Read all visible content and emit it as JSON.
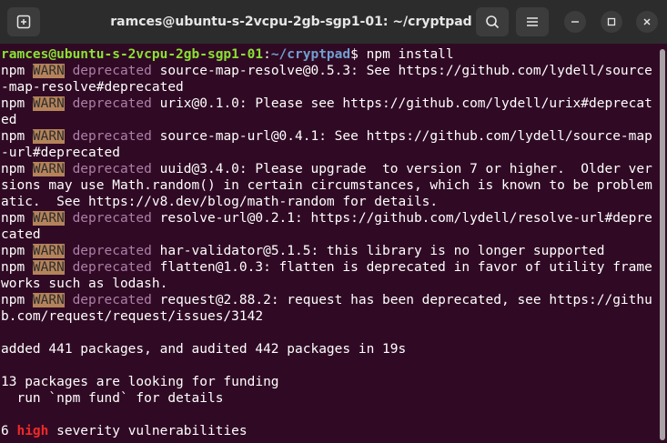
{
  "window": {
    "title": "ramces@ubuntu-s-2vcpu-2gb-sgp1-01: ~/cryptpad",
    "buttons": {
      "new_tab": "new-tab-icon",
      "search": "search-icon",
      "menu": "hamburger-icon",
      "minimize": "minimize-icon",
      "maximize": "maximize-icon",
      "close": "close-icon"
    }
  },
  "terminal": {
    "prompt_user": "ramces@ubuntu-s-2vcpu-2gb-sgp1-01",
    "prompt_sep": ":",
    "prompt_path": "~/cryptpad",
    "prompt_dollar": "$ ",
    "command": "npm install",
    "npm": "npm",
    "warn": "WARN",
    "deprecated": "deprecated",
    "warnings": [
      " source-map-resolve@0.5.3: See https://github.com/lydell/source-map-resolve#deprecated",
      " urix@0.1.0: Please see https://github.com/lydell/urix#deprecated",
      " source-map-url@0.4.1: See https://github.com/lydell/source-map-url#deprecated",
      " uuid@3.4.0: Please upgrade  to version 7 or higher.  Older versions may use Math.random() in certain circumstances, which is known to be problematic.  See https://v8.dev/blog/math-random for details.",
      " resolve-url@0.2.1: https://github.com/lydell/resolve-url#deprecated",
      " har-validator@5.1.5: this library is no longer supported",
      " flatten@1.0.3: flatten is deprecated in favor of utility frameworks such as lodash.",
      " request@2.88.2: request has been deprecated, see https://github.com/request/request/issues/3142"
    ],
    "added_line": "added 441 packages, and audited 442 packages in 19s",
    "funding_line": "13 packages are looking for funding",
    "fund_line": "  run `npm fund` for details",
    "vuln_count": "6 ",
    "vuln_level": "high",
    "vuln_rest": " severity vulnerabilities"
  }
}
